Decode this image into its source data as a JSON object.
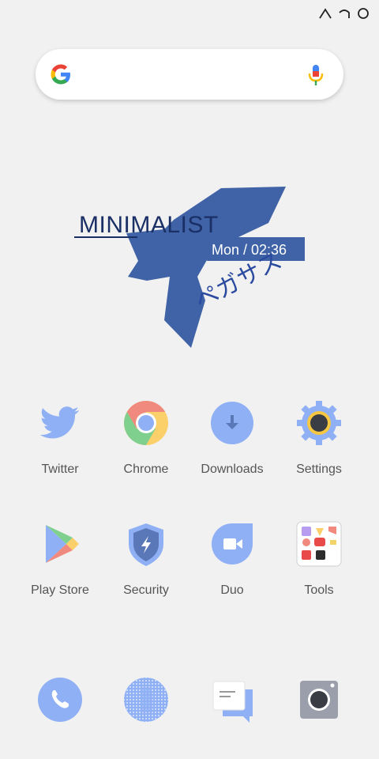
{
  "status_bar": {
    "icons": [
      "nav-back-line-icon",
      "nav-back-arrow-icon",
      "nav-home-circle-icon"
    ]
  },
  "search": {
    "logo": "google-g-icon",
    "mic": "microphone-icon"
  },
  "widget": {
    "title": "MINIMALIST",
    "time": "Mon / 02:36",
    "kana": "ペガサス",
    "accent_color": "#3f63a6"
  },
  "apps_row1": [
    {
      "label": "Twitter",
      "icon": "twitter-bird-icon"
    },
    {
      "label": "Chrome",
      "icon": "chrome-icon"
    },
    {
      "label": "Downloads",
      "icon": "download-arrow-icon"
    },
    {
      "label": "Settings",
      "icon": "gear-icon"
    }
  ],
  "apps_row2": [
    {
      "label": "Play Store",
      "icon": "play-store-icon"
    },
    {
      "label": "Security",
      "icon": "shield-bolt-icon"
    },
    {
      "label": "Duo",
      "icon": "duo-video-icon"
    },
    {
      "label": "Tools",
      "icon": "tools-folder-icon"
    }
  ],
  "dock": [
    {
      "icon": "phone-icon"
    },
    {
      "icon": "contacts-dotted-icon"
    },
    {
      "icon": "messages-icon"
    },
    {
      "icon": "camera-icon"
    }
  ],
  "colors": {
    "icon_blue": "#8fb0f5",
    "dark_navy": "#1a2f66",
    "widget_blue": "#3f63a6"
  }
}
